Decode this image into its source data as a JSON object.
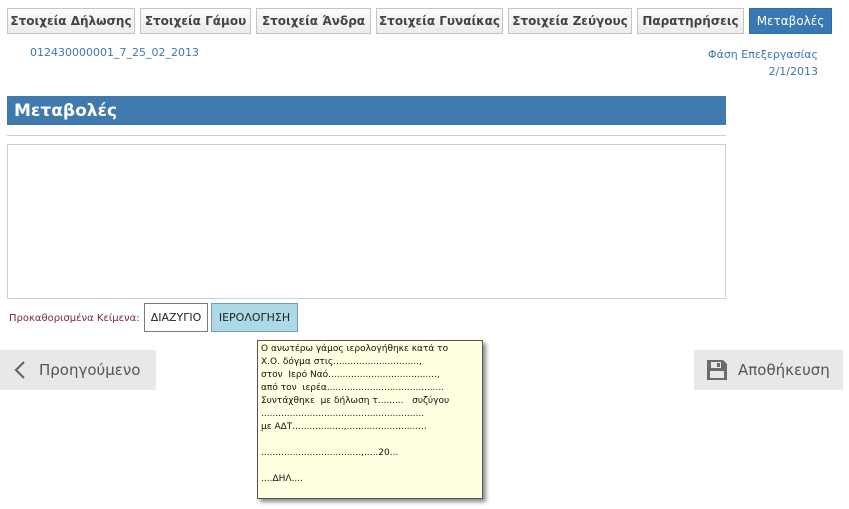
{
  "tabs": [
    {
      "label": "Στοιχεία Δήλωσης",
      "active": false
    },
    {
      "label": "Στοιχεία Γάμου",
      "active": false
    },
    {
      "label": "Στοιχεία Άνδρα",
      "active": false
    },
    {
      "label": "Στοιχεία Γυναίκας",
      "active": false
    },
    {
      "label": "Στοιχεία Ζεύγους",
      "active": false
    },
    {
      "label": "Παρατηρήσεις",
      "active": false
    },
    {
      "label": "Μεταβολές",
      "active": true
    }
  ],
  "header": {
    "reference": "012430000001_7_25_02_2013",
    "phase_label": "Φάση Επεξεργασίας",
    "phase_date": "2/1/2013"
  },
  "section": {
    "title": "Μεταβολές",
    "notes_value": ""
  },
  "predefined": {
    "label": "Προκαθορισμένα Κείμενα:",
    "buttons": [
      "ΔΙΑΖΥΓΙΟ",
      "ΙΕΡΟΛΟΓΗΣΗ"
    ]
  },
  "nav": {
    "prev_label": "Προηγούμενο",
    "prev_icon": "chevron-left-icon",
    "save_label": "Αποθήκευση",
    "save_icon": "floppy-disk-icon"
  },
  "tooltip": {
    "text": "Ο ανωτέρω γάμος ιερολογήθηκε κατά το\nΧ.Ο. δόγμα στις..............................,\nστον  Ιερό Ναό......................................,\nαπό τον  ιερέα.........................................\nΣυντάχθηκε  με δήλωση τ.........   συζύγου\n.........................................................\nμε ΑΔΤ..................,............................\n\n...................................,.....20...\n\n....ΔΗΛ....\n"
  },
  "colors": {
    "accent": "#3a78b4",
    "section_header": "#3f79ad",
    "tooltip_bg": "#ffffe1",
    "selected_button": "#add8e6",
    "nav_button_bg": "#e8e8e8"
  }
}
